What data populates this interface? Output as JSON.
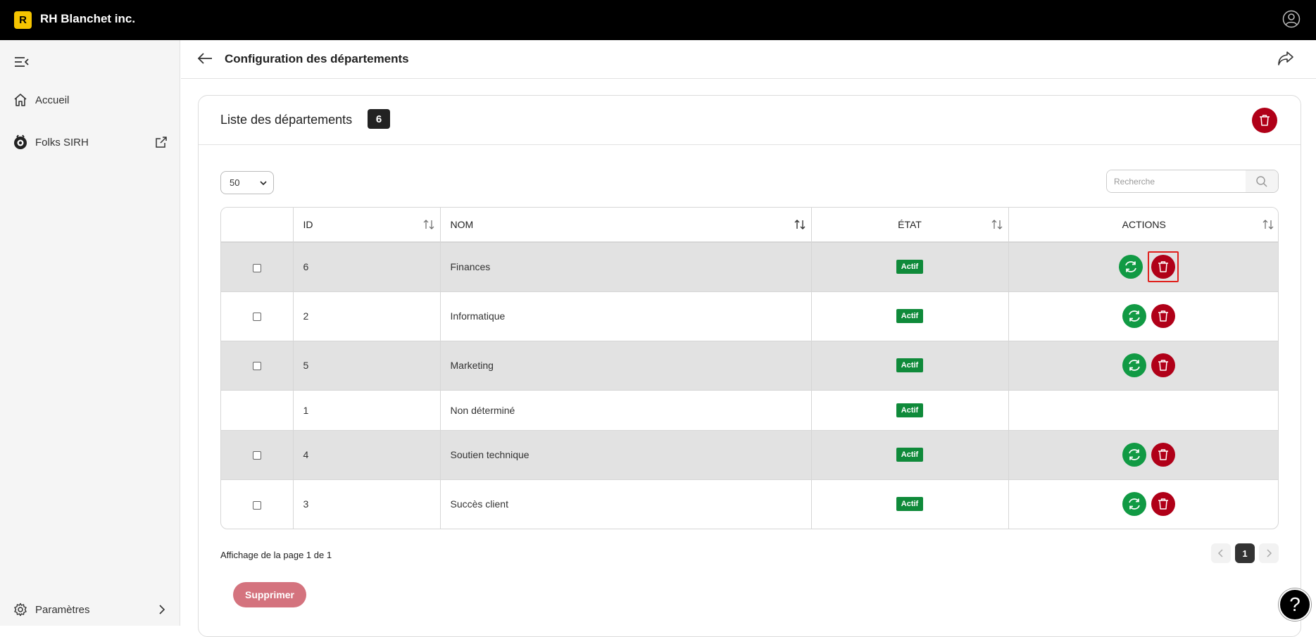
{
  "app": {
    "logo_letter": "R",
    "brand_name": "RH Blanchet inc."
  },
  "sidebar": {
    "items": [
      {
        "label": "Accueil",
        "icon": "home-icon"
      },
      {
        "label": "Folks SIRH",
        "icon": "folks-logo-icon"
      }
    ],
    "settings_label": "Paramètres"
  },
  "header": {
    "title": "Configuration des départements"
  },
  "card": {
    "title": "Liste des départements",
    "count": "6"
  },
  "controls": {
    "page_size": "50",
    "search_placeholder": "Recherche"
  },
  "table": {
    "columns": [
      "ID",
      "NOM",
      "ÉTAT",
      "ACTIONS"
    ],
    "rows": [
      {
        "id": "6",
        "name": "Finances",
        "status": "Actif"
      },
      {
        "id": "2",
        "name": "Informatique",
        "status": "Actif"
      },
      {
        "id": "5",
        "name": "Marketing",
        "status": "Actif"
      },
      {
        "id": "1",
        "name": "Non déterminé",
        "status": "Actif"
      },
      {
        "id": "4",
        "name": "Soutien technique",
        "status": "Actif"
      },
      {
        "id": "3",
        "name": "Succès client",
        "status": "Actif"
      }
    ]
  },
  "footer": {
    "page_info": "Affichage de la page 1 de 1",
    "current_page": "1",
    "delete_label": "Supprimer"
  },
  "help": {
    "label": "?"
  },
  "colors": {
    "topbar": "#000000",
    "accent": "#f5c400",
    "danger": "#b00018",
    "success": "#119a44"
  }
}
